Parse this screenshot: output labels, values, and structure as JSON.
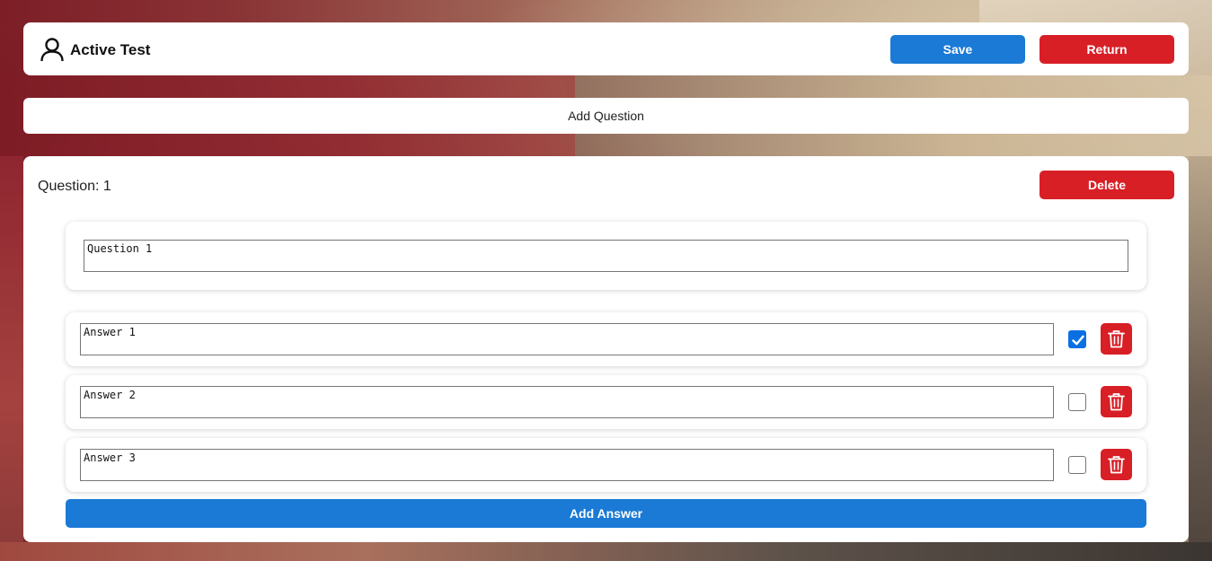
{
  "header": {
    "title": "Active Test",
    "save_label": "Save",
    "return_label": "Return"
  },
  "add_question_label": "Add Question",
  "question": {
    "label": "Question: 1",
    "delete_label": "Delete",
    "text": "Question 1",
    "answers": [
      {
        "text": "Answer 1",
        "correct": true
      },
      {
        "text": "Answer 2",
        "correct": false
      },
      {
        "text": "Answer 3",
        "correct": false
      }
    ],
    "add_answer_label": "Add Answer"
  },
  "icons": {
    "user": "user-icon",
    "check": "check-icon",
    "trash": "trash-icon"
  },
  "colors": {
    "primary": "#1a7ad6",
    "danger": "#d81f26",
    "checkbox_checked": "#0b6fe4"
  }
}
